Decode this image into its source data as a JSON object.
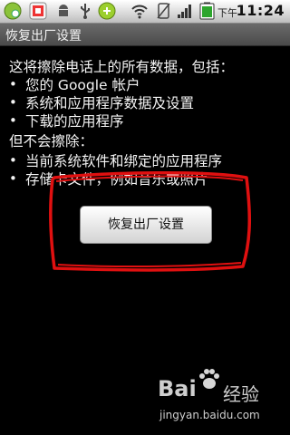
{
  "status_bar": {
    "ampm": "下午",
    "time": "11:24",
    "icons": [
      "app-icon-1",
      "app-icon-2",
      "android-icon",
      "usb-icon",
      "app-icon-3",
      "wifi-icon",
      "no-sim-icon",
      "signal-icon",
      "battery-icon"
    ]
  },
  "title_bar": {
    "title": "恢复出厂设置"
  },
  "content": {
    "intro": "这将擦除电话上的所有数据，包括：",
    "erase_items": [
      "您的 Google 帐户",
      "系统和应用程序数据及设置",
      "下载的应用程序"
    ],
    "keep_heading": "但不会擦除：",
    "keep_items": [
      "当前系统软件和绑定的应用程序",
      "存储卡文件，例如音乐或照片"
    ],
    "bullet": "•"
  },
  "button": {
    "label": "恢复出厂设置"
  },
  "watermark": {
    "brand": "Bai",
    "brand2": "经验",
    "url": "jingyan.baidu.com"
  },
  "colors": {
    "annotation": "#e01010",
    "background": "#000000"
  }
}
